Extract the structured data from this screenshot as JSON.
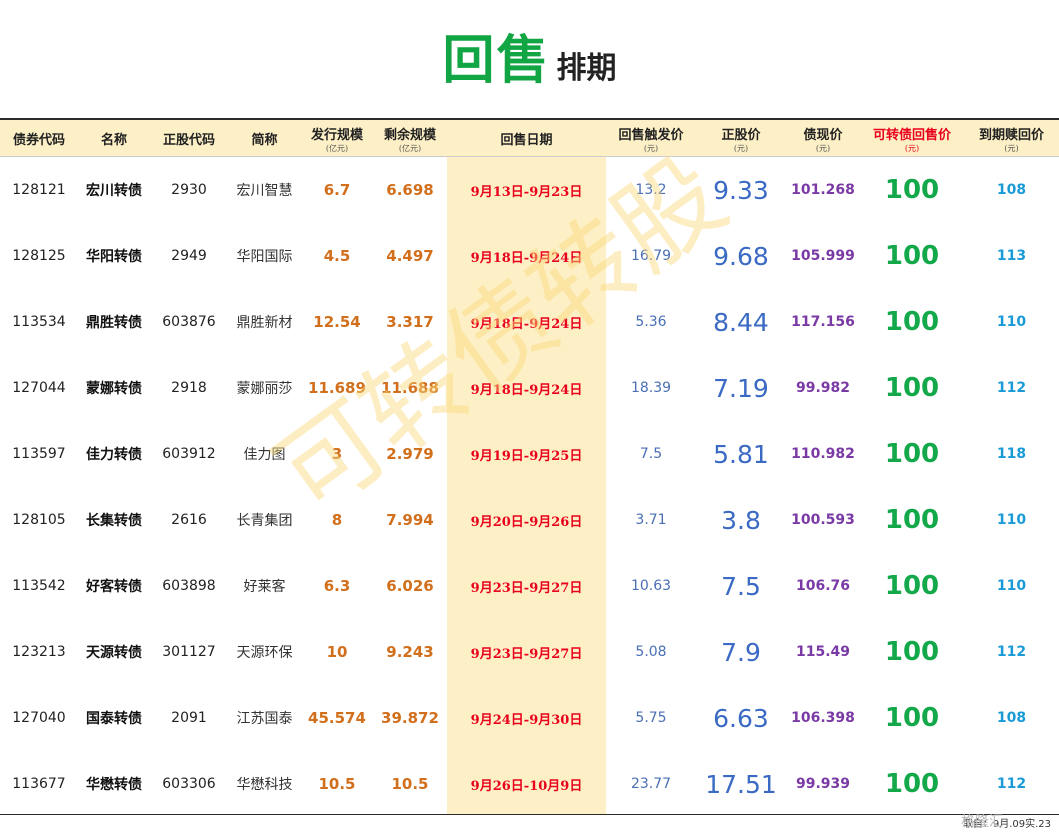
{
  "title": {
    "main": "回售",
    "sub": "排期"
  },
  "watermark": "可转债转股",
  "columns": [
    {
      "label": "债券代码",
      "unit": ""
    },
    {
      "label": "名称",
      "unit": ""
    },
    {
      "label": "正股代码",
      "unit": ""
    },
    {
      "label": "简称",
      "unit": ""
    },
    {
      "label": "发行规模",
      "unit": "(亿元)"
    },
    {
      "label": "剩余规模",
      "unit": "(亿元)"
    },
    {
      "label": "回售日期",
      "unit": ""
    },
    {
      "label": "回售触发价",
      "unit": "(元)"
    },
    {
      "label": "正股价",
      "unit": "(元)"
    },
    {
      "label": "债现价",
      "unit": "(元)"
    },
    {
      "label": "可转债回售价",
      "unit": "(元)"
    },
    {
      "label": "到期赎回价",
      "unit": "(元)"
    }
  ],
  "rows": [
    [
      "128121",
      "宏川转债",
      "2930",
      "宏川智慧",
      "6.7",
      "6.698",
      "9月13日-9月23日",
      "13.2",
      "9.33",
      "101.268",
      "100",
      "108"
    ],
    [
      "128125",
      "华阳转债",
      "2949",
      "华阳国际",
      "4.5",
      "4.497",
      "9月18日-9月24日",
      "16.79",
      "9.68",
      "105.999",
      "100",
      "113"
    ],
    [
      "113534",
      "鼎胜转债",
      "603876",
      "鼎胜新材",
      "12.54",
      "3.317",
      "9月18日-9月24日",
      "5.36",
      "8.44",
      "117.156",
      "100",
      "110"
    ],
    [
      "127044",
      "蒙娜转债",
      "2918",
      "蒙娜丽莎",
      "11.689",
      "11.688",
      "9月18日-9月24日",
      "18.39",
      "7.19",
      "99.982",
      "100",
      "112"
    ],
    [
      "113597",
      "佳力转债",
      "603912",
      "佳力图",
      "3",
      "2.979",
      "9月19日-9月25日",
      "7.5",
      "5.81",
      "110.982",
      "100",
      "118"
    ],
    [
      "128105",
      "长集转债",
      "2616",
      "长青集团",
      "8",
      "7.994",
      "9月20日-9月26日",
      "3.71",
      "3.8",
      "100.593",
      "100",
      "110"
    ],
    [
      "113542",
      "好客转债",
      "603898",
      "好莱客",
      "6.3",
      "6.026",
      "9月23日-9月27日",
      "10.63",
      "7.5",
      "106.76",
      "100",
      "110"
    ],
    [
      "123213",
      "天源转债",
      "301127",
      "天源环保",
      "10",
      "9.243",
      "9月23日-9月27日",
      "5.08",
      "7.9",
      "115.49",
      "100",
      "112"
    ],
    [
      "127040",
      "国泰转债",
      "2091",
      "江苏国泰",
      "45.574",
      "39.872",
      "9月24日-9月30日",
      "5.75",
      "6.63",
      "106.398",
      "100",
      "108"
    ],
    [
      "113677",
      "华懋转债",
      "603306",
      "华懋科技",
      "10.5",
      "10.5",
      "9月26日-10月9日",
      "23.77",
      "17.51",
      "99.939",
      "100",
      "112"
    ]
  ],
  "footer": "取自：9月.09实.23",
  "brand": "格隆汇"
}
